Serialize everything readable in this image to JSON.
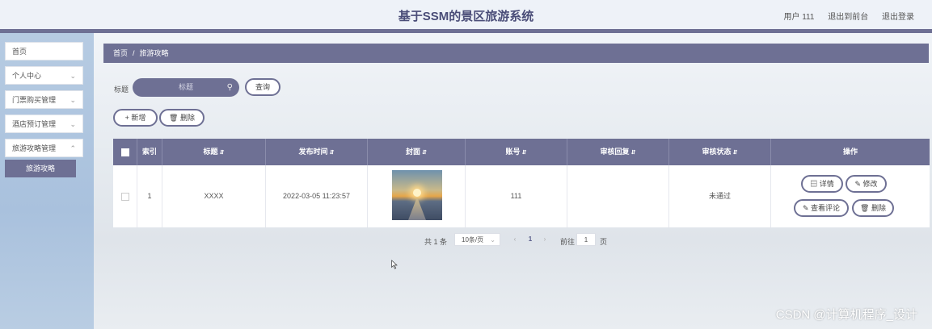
{
  "header": {
    "title": "基于SSM的景区旅游系统",
    "user": "用户 111",
    "back_to_front": "退出到前台",
    "logout": "退出登录"
  },
  "sidebar": {
    "items": [
      {
        "label": "首页"
      },
      {
        "label": "个人中心"
      },
      {
        "label": "门票购买管理"
      },
      {
        "label": "酒店预订管理"
      },
      {
        "label": "旅游攻略管理"
      }
    ],
    "sub_item": "旅游攻略"
  },
  "breadcrumb": {
    "home": "首页",
    "sep": "/",
    "current": "旅游攻略"
  },
  "search": {
    "label": "标题",
    "placeholder": "标题",
    "button": "查询"
  },
  "actions": {
    "add": "新增",
    "delete": "删除"
  },
  "table": {
    "columns": [
      "索引",
      "标题",
      "发布时间",
      "封面",
      "账号",
      "审核回复",
      "审核状态",
      "操作"
    ],
    "rows": [
      {
        "index": "1",
        "title": "XXXX",
        "publish_time": "2022-03-05 11:23:57",
        "account": "111",
        "review_reply": "",
        "review_status": "未通过"
      }
    ],
    "row_actions": {
      "detail": "详情",
      "edit": "修改",
      "comments": "查看评论",
      "delete": "删除"
    }
  },
  "pagination": {
    "total": "共 1 条",
    "page_size": "10条/页",
    "current_page": "1",
    "goto_label": "前往",
    "goto_value": "1",
    "page_suffix": "页"
  },
  "watermark": "CSDN @计算机程序_设计",
  "colors": {
    "primary": "#6e7094",
    "sidebar": "#afc6df"
  }
}
